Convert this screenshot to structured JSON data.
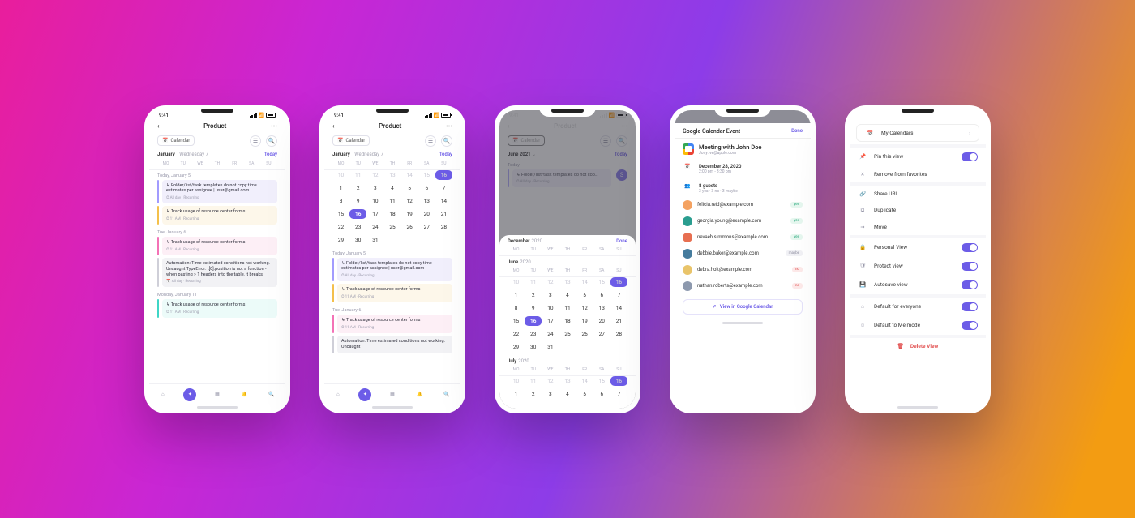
{
  "status": {
    "time": "9:41"
  },
  "phone1": {
    "title": "Product",
    "calendar_label": "Calendar",
    "sub_month": "January",
    "sub_day": "Wednesday 7",
    "today": "Today",
    "dow": [
      "MO",
      "TU",
      "WE",
      "TH",
      "FR",
      "SA",
      "SU"
    ],
    "groups": [
      {
        "label": "Today, January 5",
        "tasks": [
          {
            "color": "purple",
            "title": "↳ Folder/list/task templates do not copy time estimates per assignee | user@gmail.com",
            "meta": "⏱ All day · Recurring"
          },
          {
            "color": "yellow",
            "title": "↳ Track usage of resource center forms",
            "meta": "⏱ 11 AM · Recurring"
          }
        ]
      },
      {
        "label": "Tue, January 6",
        "tasks": [
          {
            "color": "pink",
            "title": "↳ Track usage of resource center forms",
            "meta": "⏱ 11 AM · Recurring"
          },
          {
            "color": "gray",
            "title": "Automation: Time estimated conditions not working. Uncaught TypeError: t[0].position is not a function - when pasting > 1 headers into the table, it breaks",
            "meta": "📅 All day · Recurring"
          }
        ]
      },
      {
        "label": "Monday, January 11",
        "tasks": [
          {
            "color": "teal",
            "title": "↳ Track usage of resource center forms",
            "meta": "⏱ 11 AM · Recurring"
          }
        ]
      }
    ]
  },
  "phone2": {
    "title": "Product",
    "calendar_label": "Calendar",
    "month": "January",
    "sub_day": "Wednesday 7",
    "today": "Today",
    "dow": [
      "MO",
      "TU",
      "WE",
      "TH",
      "FR",
      "SA",
      "SU"
    ],
    "weeks": [
      [
        "10",
        "11",
        "12",
        "13",
        "14",
        "15",
        "16"
      ],
      [
        "1",
        "2",
        "3",
        "4",
        "5",
        "6",
        "7"
      ],
      [
        "8",
        "9",
        "10",
        "11",
        "12",
        "13",
        "14"
      ],
      [
        "15",
        "16",
        "17",
        "18",
        "19",
        "20",
        "21"
      ],
      [
        "22",
        "23",
        "24",
        "25",
        "26",
        "27",
        "28"
      ],
      [
        "29",
        "30",
        "31",
        "",
        "",
        "",
        ""
      ]
    ],
    "groups": [
      {
        "label": "Today, January 5",
        "tasks": [
          {
            "color": "purple",
            "title": "↳ Folder/list/task templates do not copy time estimates per assignee | user@gmail.com",
            "meta": "⏱ All day · Recurring"
          },
          {
            "color": "yellow",
            "title": "↳ Track usage of resource center forms",
            "meta": "⏱ 11 AM · Recurring"
          }
        ]
      },
      {
        "label": "Tue, January 6",
        "tasks": [
          {
            "color": "pink",
            "title": "↳ Track usage of resource center forms",
            "meta": "⏱ 11 AM · Recurring"
          },
          {
            "color": "gray",
            "title": "Automation: Time estimated conditions not working. Uncaught",
            "meta": ""
          }
        ]
      }
    ]
  },
  "phone3": {
    "title": "Product",
    "calendar_label": "Calendar",
    "bg_month": "June 2021",
    "today": "Today",
    "done": "Done",
    "bg_group": "Today",
    "bg_task": "↳ Folder/list/task templates do not cop…",
    "bg_meta": "⏱ All day · Recurring",
    "sheet": {
      "months": [
        {
          "label_m": "December",
          "label_y": "2020",
          "dow": [
            "MO",
            "TU",
            "WE",
            "TH",
            "FR",
            "SA",
            "SU"
          ]
        },
        {
          "label_m": "June",
          "label_y": "2020",
          "dow": [
            "MO",
            "TU",
            "WE",
            "TH",
            "FR",
            "SA",
            "SU"
          ],
          "weeks": [
            [
              "10",
              "11",
              "12",
              "13",
              "14",
              "15",
              "16"
            ],
            [
              "1",
              "2",
              "3",
              "4",
              "5",
              "6",
              "7"
            ],
            [
              "8",
              "9",
              "10",
              "11",
              "12",
              "13",
              "14"
            ],
            [
              "15",
              "16",
              "17",
              "18",
              "19",
              "20",
              "21"
            ],
            [
              "22",
              "23",
              "24",
              "25",
              "26",
              "27",
              "28"
            ],
            [
              "29",
              "30",
              "31",
              "",
              "",
              "",
              ""
            ]
          ]
        },
        {
          "label_m": "July",
          "label_y": "2020",
          "dow": [
            "MO",
            "TU",
            "WE",
            "TH",
            "FR",
            "SA",
            "SU"
          ],
          "weeks": [
            [
              "10",
              "11",
              "12",
              "13",
              "14",
              "15",
              "16"
            ],
            [
              "1",
              "2",
              "3",
              "4",
              "5",
              "6",
              "7"
            ]
          ]
        }
      ]
    }
  },
  "phone4": {
    "header": "Google Calendar Event",
    "done": "Done",
    "event_title": "Meeting with John Doe",
    "event_sub": "Jony.Ive@apple.com",
    "date_main": "December 28, 2020",
    "date_sub": "2:00 pm - 3:30 pm",
    "guests_main": "8 guests",
    "guests_sub": "3 yes · 3 no · 3 maybe",
    "guests": [
      {
        "email": "felicia.reid@example.com",
        "status": "yes",
        "color": "#f4a261"
      },
      {
        "email": "georgia.young@example.com",
        "status": "yes",
        "color": "#2a9d8f"
      },
      {
        "email": "nevaeh.simmons@example.com",
        "status": "yes",
        "color": "#e76f51"
      },
      {
        "email": "debbie.baker@example.com",
        "status": "maybe",
        "color": "#457b9d"
      },
      {
        "email": "debra.holt@example.com",
        "status": "no",
        "color": "#e9c46a"
      },
      {
        "email": "nathan.roberts@example.com",
        "status": "no",
        "color": "#8d99ae"
      }
    ],
    "open_btn": "View in Google Calendar"
  },
  "phone5": {
    "top": {
      "label": "My Calendars"
    },
    "items1": [
      {
        "icon": "📌",
        "label": "Pin this view",
        "toggle": true
      },
      {
        "icon": "✕",
        "label": "Remove from favorites"
      }
    ],
    "items2": [
      {
        "icon": "🔗",
        "label": "Share URL"
      },
      {
        "icon": "⧉",
        "label": "Duplicate"
      },
      {
        "icon": "➜",
        "label": "Move"
      }
    ],
    "items3": [
      {
        "icon": "🔒",
        "label": "Personal View",
        "toggle": true
      },
      {
        "icon": "🛡",
        "label": "Protect view",
        "toggle": true
      },
      {
        "icon": "💾",
        "label": "Autosave view",
        "toggle": true
      }
    ],
    "items4": [
      {
        "icon": "⌂",
        "label": "Default for everyone",
        "toggle": true
      },
      {
        "icon": "☺",
        "label": "Default to Me mode",
        "toggle": true
      }
    ],
    "delete": "Delete View"
  }
}
